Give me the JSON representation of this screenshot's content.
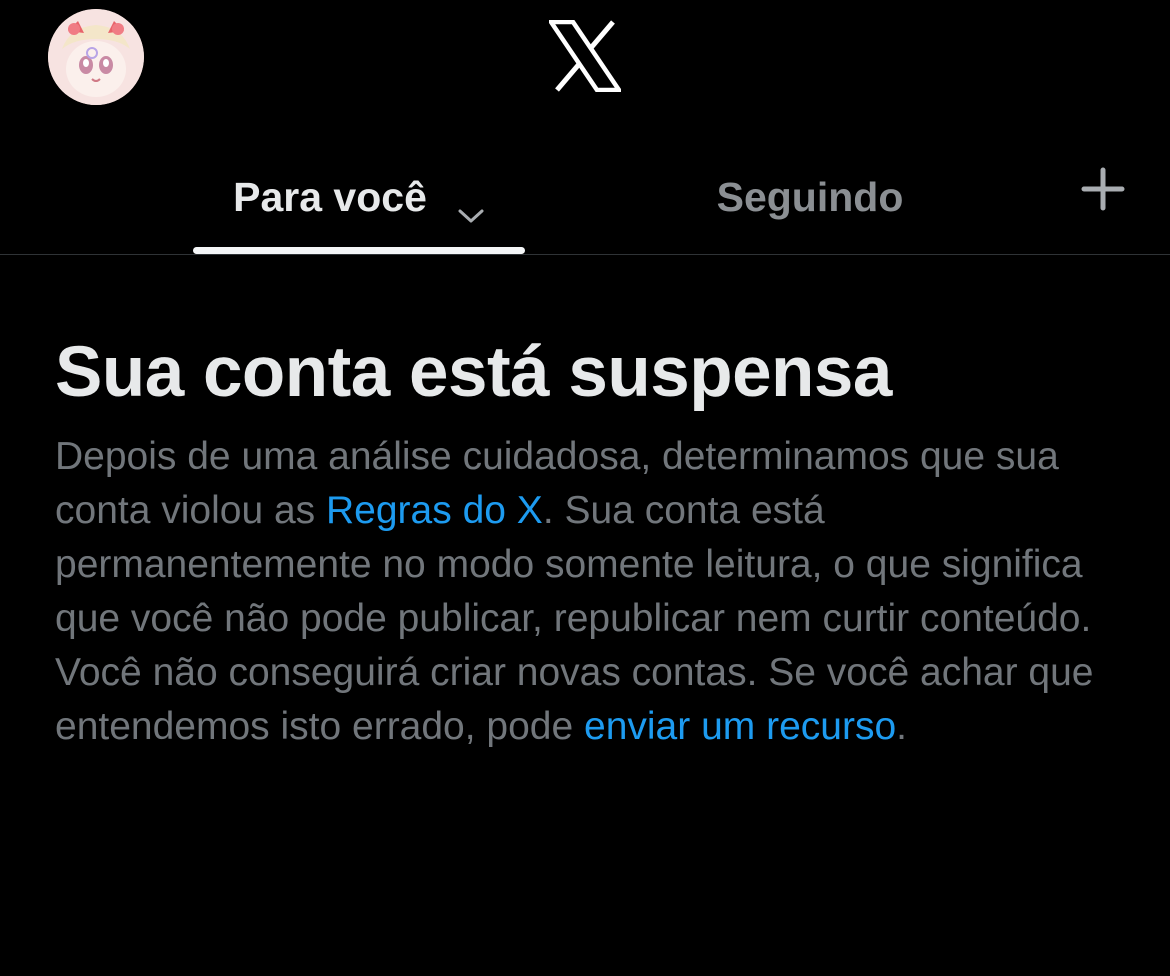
{
  "header": {
    "avatar_alt": "avatar",
    "logo": "x-logo-icon"
  },
  "tabs": [
    {
      "label": "Para você",
      "active": true,
      "icon": "chevron-down-icon"
    },
    {
      "label": "Seguindo",
      "active": false
    }
  ],
  "add_tab_icon": "plus-icon",
  "notice": {
    "title": "Sua conta está suspensa",
    "p1": "Depois de uma análise cuidadosa, determinamos que sua conta violou as ",
    "rules_link": "Regras do X",
    "p2": ". Sua conta está permanentemente no modo somente leitura, o que significa que você não pode publicar, republicar nem curtir conteúdo. Você não conseguirá criar novas contas. Se você achar que entendemos isto errado, pode ",
    "appeal_link": "enviar um recurso",
    "p3": "."
  },
  "colors": {
    "background": "#000000",
    "primary_text": "#e7e9ea",
    "secondary_text": "#71767b",
    "link": "#1d9bf0",
    "divider": "#2f3336"
  }
}
